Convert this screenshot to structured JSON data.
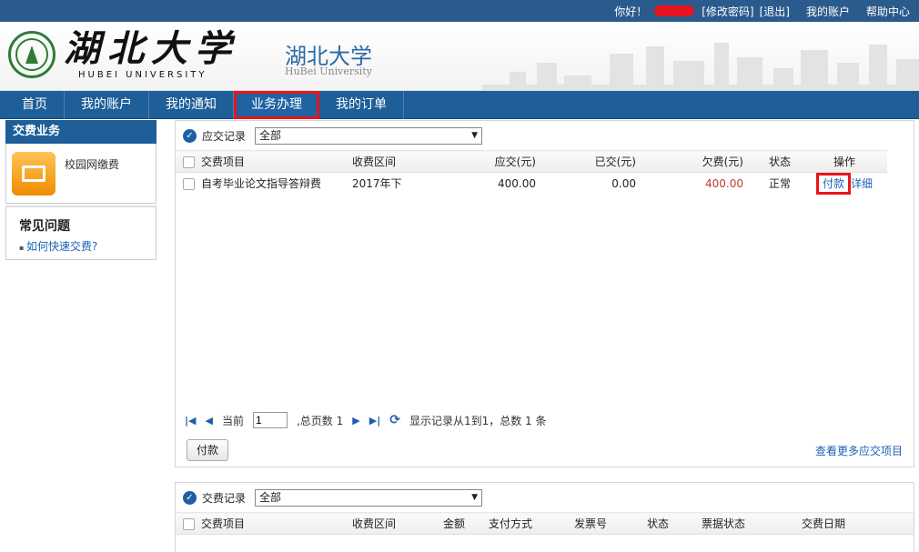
{
  "topbar": {
    "greeting": "你好！",
    "change_password": "[修改密码]",
    "logout": "[退出]",
    "my_account": "我的账户",
    "help": "帮助中心"
  },
  "header": {
    "logo_cn": "湖北大学",
    "logo_en": "HUBEI UNIVERSITY",
    "title_cn": "湖北大学",
    "title_en": "HuBei University"
  },
  "nav": {
    "items": [
      {
        "label": "首页"
      },
      {
        "label": "我的账户"
      },
      {
        "label": "我的通知"
      },
      {
        "label": "业务办理"
      },
      {
        "label": "我的订单"
      }
    ],
    "active_index": 3
  },
  "sidebar": {
    "title": "交费业务",
    "item_label": "校园网缴费",
    "faq_title": "常见问题",
    "faq_link": "如何快速交费?"
  },
  "due_panel": {
    "title": "应交记录",
    "filter_value": "全部",
    "columns": [
      "交费项目",
      "收费区间",
      "应交(元)",
      "已交(元)",
      "欠费(元)",
      "状态",
      "操作"
    ],
    "rows": [
      {
        "item": "自考毕业论文指导答辩费",
        "period": "2017年下",
        "due": "400.00",
        "paid": "0.00",
        "owed": "400.00",
        "status": "正常",
        "pay": "付款",
        "detail": "详细"
      }
    ],
    "pager": {
      "current_label": "当前",
      "current_page": "1",
      "total_label": ",总页数",
      "total_pages": "1",
      "summary": "显示记录从1到1，总数 1 条"
    },
    "pay_button": "付款",
    "more_link": "查看更多应交项目"
  },
  "paid_panel": {
    "title": "交费记录",
    "filter_value": "全部",
    "columns": [
      "交费项目",
      "收费区间",
      "金额",
      "支付方式",
      "发票号",
      "状态",
      "票据状态",
      "交费日期"
    ]
  },
  "colors": {
    "topbar": "#2b5a8c",
    "nav": "#1e5e99",
    "highlight": "#e8141d",
    "link": "#1a62b7"
  }
}
